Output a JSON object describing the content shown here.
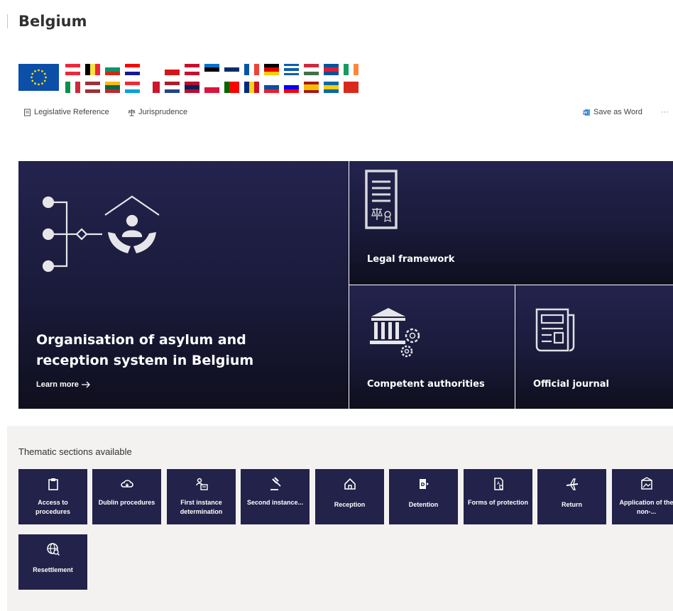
{
  "page": {
    "title": "Belgium"
  },
  "flags": {
    "eu": {
      "name": "eu-flag",
      "colors": [
        "#0b4fa8",
        "#ffdd00"
      ]
    },
    "row1": [
      {
        "name": "austria",
        "dir": "h",
        "colors": [
          "#ed2939",
          "#ffffff",
          "#ed2939"
        ]
      },
      {
        "name": "belgium",
        "dir": "v",
        "colors": [
          "#000000",
          "#fae042",
          "#ed2939"
        ]
      },
      {
        "name": "bulgaria",
        "dir": "h",
        "colors": [
          "#ffffff",
          "#00966e",
          "#d62612"
        ]
      },
      {
        "name": "croatia",
        "dir": "h",
        "colors": [
          "#ff0000",
          "#ffffff",
          "#171796"
        ]
      },
      {
        "name": "cyprus",
        "dir": "h",
        "colors": [
          "#ffffff",
          "#ffffff",
          "#ffffff"
        ]
      },
      {
        "name": "czechia",
        "dir": "h",
        "colors": [
          "#ffffff",
          "#d7141a"
        ]
      },
      {
        "name": "denmark",
        "dir": "h",
        "colors": [
          "#c8102e",
          "#ffffff",
          "#c8102e"
        ]
      },
      {
        "name": "estonia",
        "dir": "h",
        "colors": [
          "#0072ce",
          "#000000",
          "#ffffff"
        ]
      },
      {
        "name": "finland",
        "dir": "h",
        "colors": [
          "#ffffff",
          "#002f6c",
          "#ffffff"
        ]
      },
      {
        "name": "france",
        "dir": "v",
        "colors": [
          "#0055a4",
          "#ffffff",
          "#ef4135"
        ]
      },
      {
        "name": "germany",
        "dir": "h",
        "colors": [
          "#000000",
          "#dd0000",
          "#ffce00"
        ]
      },
      {
        "name": "greece",
        "dir": "h",
        "colors": [
          "#0d5eaf",
          "#ffffff",
          "#0d5eaf",
          "#ffffff",
          "#0d5eaf"
        ]
      },
      {
        "name": "hungary",
        "dir": "h",
        "colors": [
          "#cd2a3e",
          "#ffffff",
          "#436f4d"
        ]
      },
      {
        "name": "iceland",
        "dir": "h",
        "colors": [
          "#02529c",
          "#dc1e35",
          "#02529c"
        ]
      },
      {
        "name": "ireland",
        "dir": "v",
        "colors": [
          "#169b62",
          "#ffffff",
          "#ff883e"
        ]
      }
    ],
    "row2": [
      {
        "name": "italy",
        "dir": "v",
        "colors": [
          "#009246",
          "#ffffff",
          "#ce2b37"
        ]
      },
      {
        "name": "latvia",
        "dir": "h",
        "colors": [
          "#9e3039",
          "#ffffff",
          "#9e3039"
        ]
      },
      {
        "name": "lithuania",
        "dir": "h",
        "colors": [
          "#fdb913",
          "#006a44",
          "#c1272d"
        ]
      },
      {
        "name": "luxembourg",
        "dir": "h",
        "colors": [
          "#ed2939",
          "#ffffff",
          "#00a1de"
        ]
      },
      {
        "name": "malta",
        "dir": "v",
        "colors": [
          "#ffffff",
          "#cf142b"
        ]
      },
      {
        "name": "netherlands",
        "dir": "h",
        "colors": [
          "#ae1c28",
          "#ffffff",
          "#21468b"
        ]
      },
      {
        "name": "norway",
        "dir": "h",
        "colors": [
          "#ba0c2f",
          "#00205b",
          "#ba0c2f"
        ]
      },
      {
        "name": "poland",
        "dir": "h",
        "colors": [
          "#ffffff",
          "#dc143c"
        ]
      },
      {
        "name": "portugal",
        "dir": "v",
        "colors": [
          "#006600",
          "#ff0000",
          "#ff0000"
        ]
      },
      {
        "name": "romania",
        "dir": "v",
        "colors": [
          "#002b7f",
          "#fcd116",
          "#ce1126"
        ]
      },
      {
        "name": "slovakia",
        "dir": "h",
        "colors": [
          "#ffffff",
          "#0b4ea2",
          "#ee1c25"
        ]
      },
      {
        "name": "slovenia",
        "dir": "h",
        "colors": [
          "#ffffff",
          "#0000ff",
          "#ff0000"
        ]
      },
      {
        "name": "spain",
        "dir": "h",
        "colors": [
          "#aa151b",
          "#f1bf00",
          "#f1bf00",
          "#aa151b"
        ]
      },
      {
        "name": "sweden",
        "dir": "h",
        "colors": [
          "#006aa7",
          "#fecc00",
          "#006aa7"
        ]
      },
      {
        "name": "switzerland",
        "dir": "h",
        "colors": [
          "#da291c",
          "#da291c"
        ]
      }
    ]
  },
  "toolbar": {
    "legislative_reference": "Legislative Reference",
    "jurisprudence": "Jurisprudence",
    "save_as_word": "Save as Word",
    "more": "···"
  },
  "hero": {
    "main_title": "Organisation of asylum and reception system in Belgium",
    "learn_more": "Learn more",
    "legal_framework": "Legal framework",
    "competent_authorities": "Competent authorities",
    "official_journal": "Official journal"
  },
  "themes": {
    "heading": "Thematic sections available",
    "items": [
      {
        "label": "Access to procedures",
        "icon": "clipboard-icon"
      },
      {
        "label": "Dublin procedures",
        "icon": "cloud-sync-icon"
      },
      {
        "label": "First instance determination",
        "icon": "people-icon"
      },
      {
        "label": "Second instance...",
        "icon": "gavel-icon"
      },
      {
        "label": "Reception",
        "icon": "home-icon"
      },
      {
        "label": "Detention",
        "icon": "door-icon"
      },
      {
        "label": "Forms of protection",
        "icon": "document-shield-icon"
      },
      {
        "label": "Return",
        "icon": "airplane-icon"
      },
      {
        "label": "Application of the non-...",
        "icon": "image-building-icon"
      },
      {
        "label": "Resettlement",
        "icon": "globe-icon"
      }
    ]
  },
  "colors": {
    "tile_dark": "#1a1a3a",
    "theme_tile": "#22224a",
    "themes_bg": "#f3f2f1",
    "word_blue": "#185abd"
  }
}
